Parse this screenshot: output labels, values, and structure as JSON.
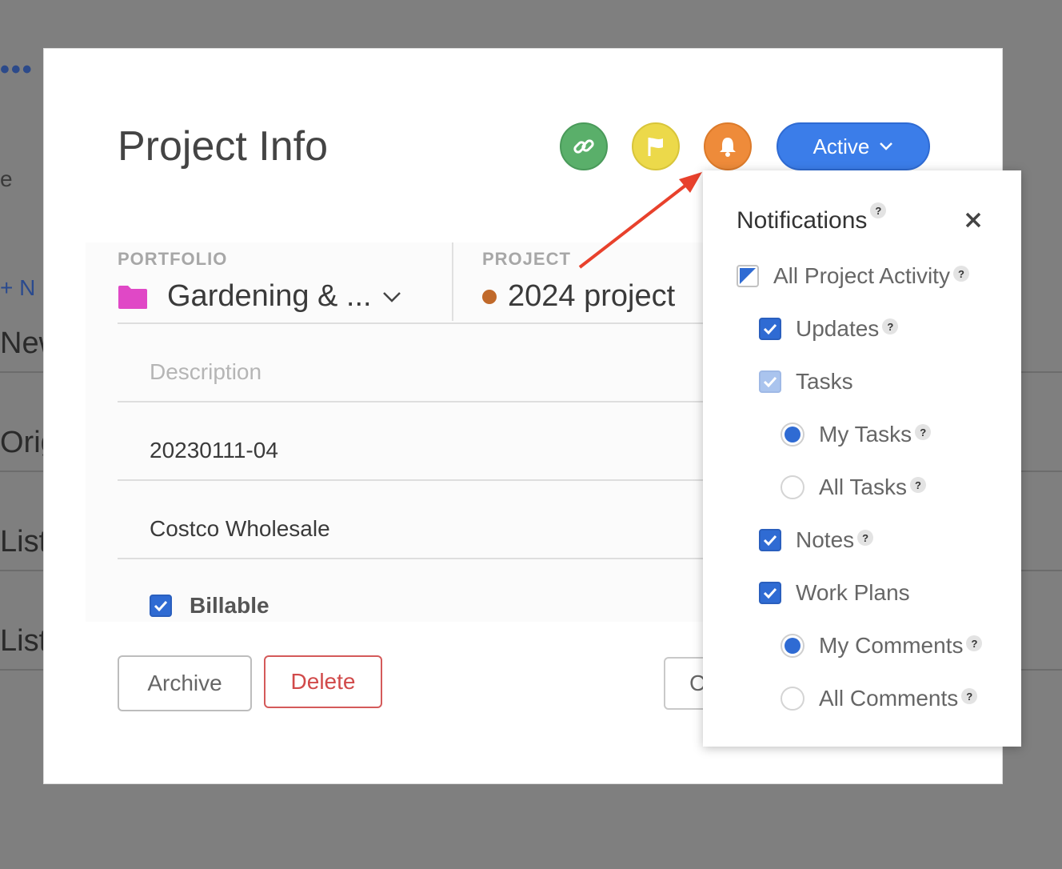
{
  "background": {
    "dots": "•••",
    "e_text": "e",
    "new_link": "+ N",
    "rows": [
      "New",
      "Orig",
      "List",
      "List"
    ]
  },
  "modal": {
    "title": "Project Info",
    "icons": [
      "link-icon",
      "flag-icon",
      "bell-icon"
    ],
    "status_label": "Active",
    "portfolio_label": "PORTFOLIO",
    "portfolio_value": "Gardening & ...",
    "project_label": "PROJECT",
    "project_value": "2024 project",
    "description_placeholder": "Description",
    "project_code": "20230111-04",
    "client": "Costco Wholesale",
    "billable_label": "Billable",
    "archive_label": "Archive",
    "delete_label": "Delete",
    "close_label": "C"
  },
  "notifications": {
    "title": "Notifications",
    "help": "?",
    "options": {
      "all_project_activity": "All Project Activity",
      "updates": "Updates",
      "tasks": "Tasks",
      "my_tasks": "My Tasks",
      "all_tasks": "All Tasks",
      "notes": "Notes",
      "work_plans": "Work Plans",
      "my_comments": "My Comments",
      "all_comments": "All Comments"
    }
  },
  "colors": {
    "link_button": "#5aaf6a",
    "flag_button": "#ecd94a",
    "bell_button": "#ee8b3a",
    "status_button": "#3b7de9",
    "portfolio_folder": "#e048c6",
    "project_dot": "#c0692a",
    "checkbox": "#2f6bd3",
    "arrow": "#e8412c"
  }
}
